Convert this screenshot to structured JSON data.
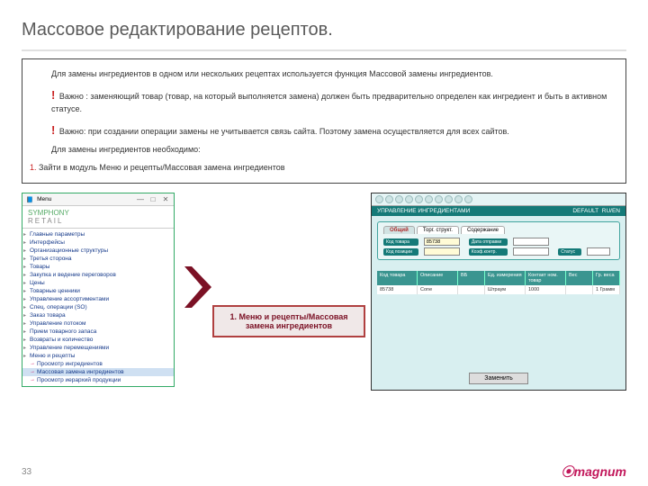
{
  "title": "Массовое редактирование рецептов.",
  "intro": "Для замены ингредиентов в одном или нескольких рецептах используется функция Массовой замены ингредиентов.",
  "warn1": "Важно : заменяющий товар (товар, на который выполняется замена) должен быть предварительно определен как ингредиент и быть в активном статусе.",
  "warn2": "Важно: при создании операции замены не учитывается связь сайта. Поэтому замена осуществляется для всех сайтов.",
  "lead": "Для замены ингредиентов необходимо:",
  "step1": "Зайти в модуль Меню и рецепты/Массовая замена ингредиентов",
  "callout": "1. Меню и рецепты/Массовая замена ингредиентов",
  "page_num": "33",
  "footer_logo": "magnum",
  "tree": {
    "win_title": "Menu",
    "logo1": "SYMPHONY",
    "logo2": "RETAIL",
    "items": [
      "Главные параметры",
      "Интерфейсы",
      "Организационные структуры",
      "Третья сторона",
      "Товары",
      "Закупка и ведение переговоров",
      "Цены",
      "Товарные ценники",
      "Управление ассортиментами",
      "Спец. операции (SO)",
      "Заказ товара",
      "Управление потоком",
      "Прием товарного запаса",
      "Возвраты и количество",
      "Управление перемещениями",
      "Меню и рецепты"
    ],
    "subitems": [
      "Просмотр ингредиентов",
      "Массовая замена ингредиентов",
      "Просмотр иерархий продукции"
    ]
  },
  "app": {
    "header_left": "УПРАВЛЕНИЕ ИНГРЕДИЕНТАМИ",
    "header_right_user": "DEFAULT",
    "header_right_lang": "RU/EN",
    "tabs": {
      "t1": "Общий",
      "t2": "Торг. структ.",
      "t3": "Содержание"
    },
    "fields": {
      "code_label": "Код товара",
      "code_value": "85738",
      "send_date_label": "Дата отправки",
      "pos_label": "Код позиции",
      "coef_label": "Коэф.контр.",
      "status_label": "Статус"
    },
    "grid": {
      "cols": [
        "Код товара",
        "Описание",
        "ВБ",
        "Ед. измерения",
        "Контакт ном. товар",
        "Вес",
        "Гр. веса"
      ],
      "row": [
        "85738",
        "Cone",
        "",
        "Штраум",
        "1000",
        "",
        "1 Грамм"
      ]
    },
    "button": "Заменить"
  }
}
